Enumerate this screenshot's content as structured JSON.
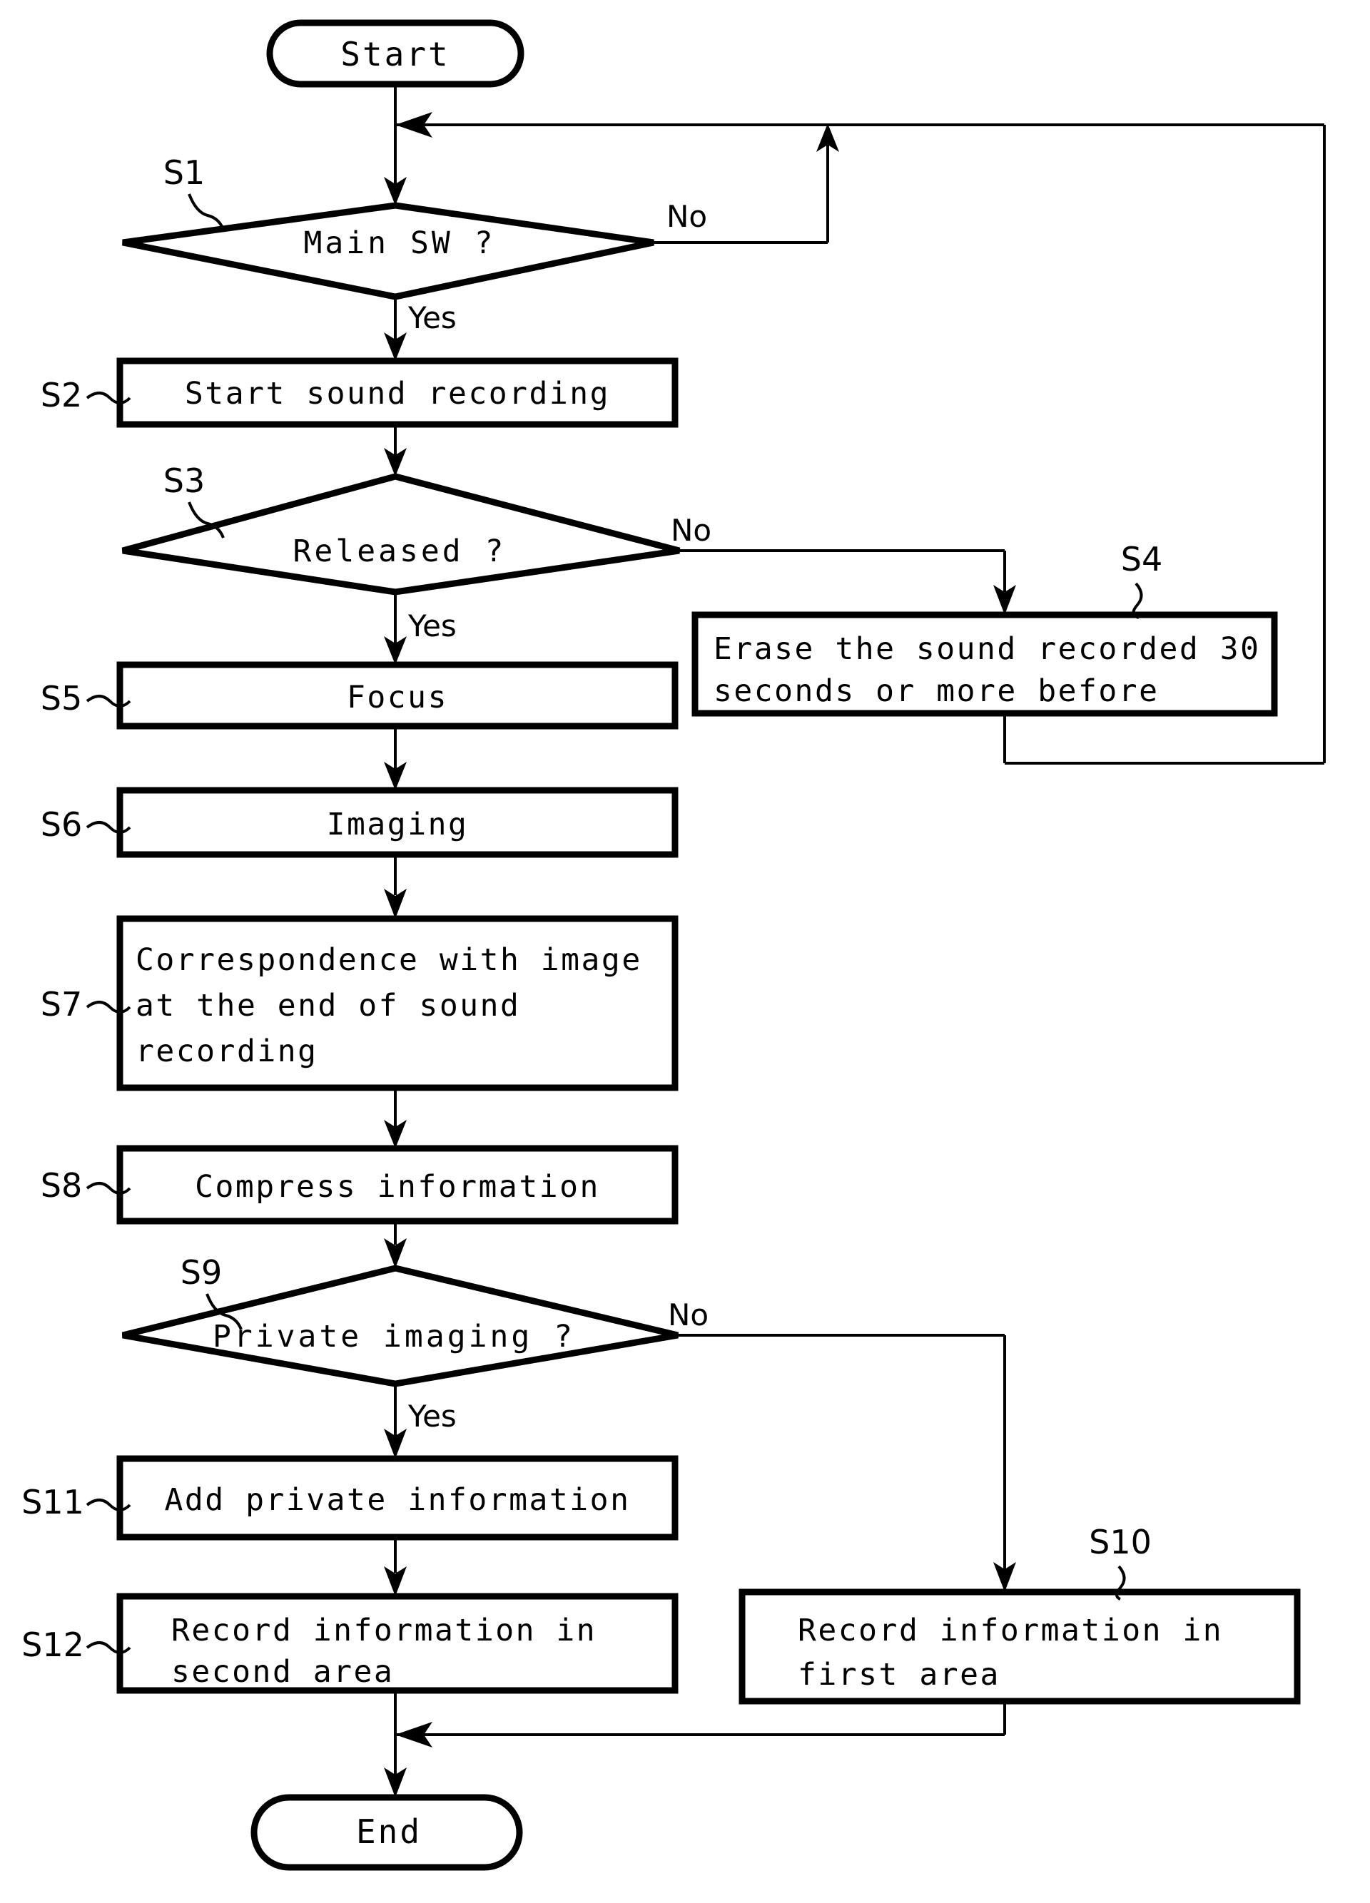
{
  "diagram": {
    "title": "Flowchart",
    "colors": {
      "ink": "#000000",
      "paper": "#ffffff"
    },
    "terminators": {
      "start": "Start",
      "end": "End"
    },
    "nodes": [
      {
        "id": "S1",
        "step": "S1",
        "kind": "decision",
        "text": "Main SW ?"
      },
      {
        "id": "S2",
        "step": "S2",
        "kind": "process",
        "text": "Start sound recording"
      },
      {
        "id": "S3",
        "step": "S3",
        "kind": "decision",
        "text": "Released ?"
      },
      {
        "id": "S4",
        "step": "S4",
        "kind": "process",
        "line1": "Erase the sound recorded 30",
        "line2": "seconds or more before"
      },
      {
        "id": "S5",
        "step": "S5",
        "kind": "process",
        "text": "Focus"
      },
      {
        "id": "S6",
        "step": "S6",
        "kind": "process",
        "text": "Imaging"
      },
      {
        "id": "S7",
        "step": "S7",
        "kind": "process",
        "line1": "Correspondence with image",
        "line2": "at the end of sound",
        "line3": "recording"
      },
      {
        "id": "S8",
        "step": "S8",
        "kind": "process",
        "text": "Compress information"
      },
      {
        "id": "S9",
        "step": "S9",
        "kind": "decision",
        "text": "Private imaging ?"
      },
      {
        "id": "S10",
        "step": "S10",
        "kind": "process",
        "line1": "Record information in",
        "line2": "first area"
      },
      {
        "id": "S11",
        "step": "S11",
        "kind": "process",
        "text": "Add private information"
      },
      {
        "id": "S12",
        "step": "S12",
        "kind": "process",
        "line1": "Record information in",
        "line2": "second area"
      }
    ],
    "edge_labels": {
      "s1_no": "No",
      "s1_yes": "Yes",
      "s3_no": "No",
      "s3_yes": "Yes",
      "s9_no": "No",
      "s9_yes": "Yes"
    }
  }
}
